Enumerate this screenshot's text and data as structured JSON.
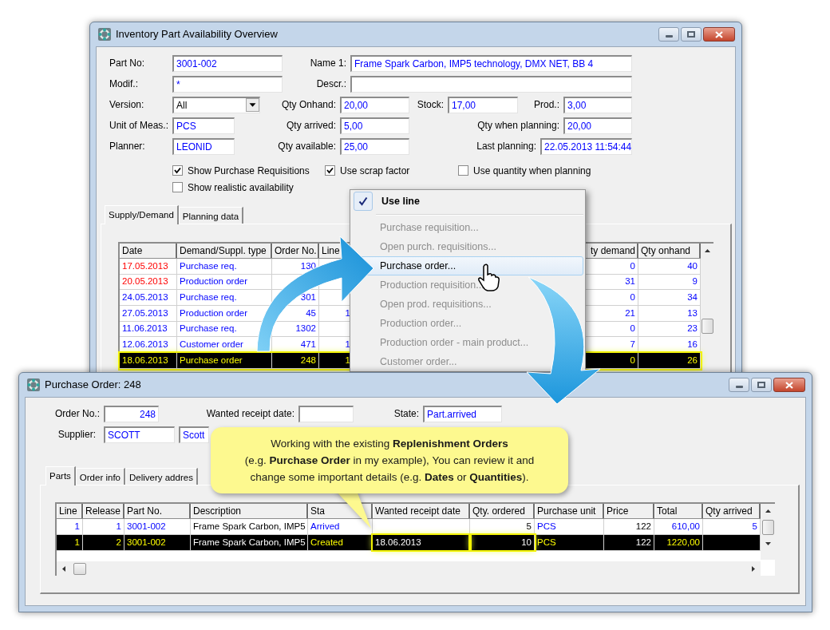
{
  "inventory_window": {
    "title": "Inventory Part Availability Overview",
    "fields": {
      "part_no": {
        "label": "Part No:",
        "value": "3001-002"
      },
      "name_1": {
        "label": "Name 1:",
        "value": "Frame Spark Carbon, IMP5 technology, DMX NET, BB 4"
      },
      "modif": {
        "label": "Modif.:",
        "value": "*"
      },
      "descr": {
        "label": "Descr.:"
      },
      "version": {
        "label": "Version:",
        "value": "All"
      },
      "qty_onhand": {
        "label": "Qty Onhand:",
        "value": "20,00"
      },
      "stock": {
        "label": "Stock:",
        "value": "17,00"
      },
      "prod": {
        "label": "Prod.:",
        "value": "3,00"
      },
      "unit": {
        "label": "Unit of Meas.:",
        "value": "PCS"
      },
      "qty_arrived": {
        "label": "Qty arrived:",
        "value": "5,00"
      },
      "qty_when_planning": {
        "label": "Qty when planning:",
        "value": "20,00"
      },
      "planner": {
        "label": "Planner:",
        "value": "LEONID"
      },
      "qty_available": {
        "label": "Qty available:",
        "value": "25,00"
      },
      "last_planning": {
        "label": "Last planning:",
        "value": "22.05.2013 11:54:44"
      }
    },
    "checkboxes": [
      {
        "label": "Show Purchase Requisitions",
        "checked": true
      },
      {
        "label": "Use scrap factor",
        "checked": true
      },
      {
        "label": "Use quantity when planning",
        "checked": false
      },
      {
        "label": "Show realistic availability",
        "checked": false
      }
    ],
    "tabs": [
      {
        "label": "Supply/Demand",
        "selected": true
      },
      {
        "label": "Planning data",
        "selected": false
      }
    ],
    "table": {
      "columns": [
        "Date",
        "Demand/Suppl. type",
        "Order No.",
        "Line",
        "ty demand",
        "Qty onhand"
      ],
      "rows": [
        {
          "date": "17.05.2013",
          "overdue": true,
          "type": "Purchase req.",
          "order_no": "130",
          "qty_demand": "0",
          "qty_onhand": "40",
          "selected": false,
          "highlighted": false
        },
        {
          "date": "20.05.2013",
          "overdue": true,
          "type": "Production order",
          "qty_demand": "31",
          "qty_onhand": "9",
          "selected": false,
          "highlighted": false
        },
        {
          "date": "24.05.2013",
          "overdue": false,
          "type": "Purchase req.",
          "order_no": "301",
          "qty_demand": "0",
          "qty_onhand": "34",
          "selected": false,
          "highlighted": false
        },
        {
          "date": "27.05.2013",
          "overdue": false,
          "type": "Production order",
          "order_no": "45",
          "line": "1",
          "qty_demand": "21",
          "qty_onhand": "13",
          "selected": false,
          "highlighted": false
        },
        {
          "date": "11.06.2013",
          "overdue": false,
          "type": "Purchase req.",
          "order_no": "1302",
          "qty_demand": "0",
          "qty_onhand": "23",
          "selected": false,
          "highlighted": false
        },
        {
          "date": "12.06.2013",
          "overdue": false,
          "type": "Customer order",
          "order_no": "471",
          "line": "1",
          "qty_demand": "7",
          "qty_onhand": "16",
          "selected": false,
          "highlighted": false
        },
        {
          "date": "18.06.2013",
          "overdue": false,
          "type": "Purchase order",
          "order_no": "248",
          "line": "1",
          "qty_demand": "0",
          "qty_onhand": "26",
          "selected": true,
          "highlighted": true
        }
      ]
    }
  },
  "context_menu": {
    "items": [
      {
        "kind": "check",
        "label": "Use line",
        "checked": true
      },
      {
        "kind": "separator"
      },
      {
        "kind": "action",
        "label": "Purchase requisition...",
        "disabled": true,
        "selected": false
      },
      {
        "kind": "action",
        "label": "Open purch. requisitions...",
        "disabled": true,
        "selected": false
      },
      {
        "kind": "action",
        "label": "Purchase order...",
        "disabled": false,
        "selected": true
      },
      {
        "kind": "action",
        "label": "Production requisition...",
        "disabled": true,
        "selected": false
      },
      {
        "kind": "action",
        "label": "Open prod. requisitions...",
        "disabled": true,
        "selected": false
      },
      {
        "kind": "action",
        "label": "Production order...",
        "disabled": true,
        "selected": false
      },
      {
        "kind": "action",
        "label": "Production order - main product...",
        "disabled": true,
        "selected": false
      },
      {
        "kind": "action",
        "label": "Customer order...",
        "disabled": true,
        "selected": false
      }
    ]
  },
  "purchase_window": {
    "title": "Purchase Order: 248",
    "fields": {
      "order_no": {
        "label": "Order No.:",
        "value": "248"
      },
      "wanted_receipt_date": {
        "label": "Wanted receipt date:"
      },
      "state": {
        "label": "State:",
        "value": "Part.arrived"
      },
      "supplier": {
        "label": "Supplier:",
        "value": "SCOTT"
      },
      "supplier_name": {
        "value": "Scott"
      }
    },
    "tabs": [
      {
        "label": "Parts",
        "selected": true
      },
      {
        "label": "Order info",
        "selected": false
      },
      {
        "label": "Delivery addres",
        "selected": false
      }
    ],
    "table": {
      "columns": [
        {
          "label": "Line",
          "highlighted": false
        },
        {
          "label": "Release",
          "highlighted": false
        },
        {
          "label": "Part No.",
          "highlighted": false
        },
        {
          "label": "Description",
          "highlighted": false
        },
        {
          "label": "Sta",
          "highlighted": false
        },
        {
          "label": "Wanted receipt date",
          "highlighted": true
        },
        {
          "label": "Qty. ordered",
          "highlighted": true
        },
        {
          "label": "Purchase unit",
          "highlighted": false
        },
        {
          "label": "Price",
          "highlighted": false
        },
        {
          "label": "Total",
          "highlighted": false
        },
        {
          "label": "Qty arrived",
          "highlighted": false
        }
      ],
      "rows": [
        {
          "line": "1",
          "release": "1",
          "part_no": "3001-002",
          "description": "Frame Spark Carbon, IMP5",
          "state": "Arrived",
          "qty_ordered": "5",
          "unit": "PCS",
          "price": "122",
          "total": "610,00",
          "qty_arrived": "5",
          "selected": false
        },
        {
          "line": "1",
          "release": "2",
          "part_no": "3001-002",
          "description": "Frame Spark Carbon, IMP5",
          "state": "Created",
          "wanted_date": "18.06.2013",
          "qty_ordered": "10",
          "unit": "PCS",
          "price": "122",
          "total": "1220,00",
          "selected": true
        }
      ]
    }
  },
  "callout": {
    "lines": [
      "Working with the existing **Replenishment Orders**",
      "(e.g. **Purchase Order** in my example), You can review it and",
      "change some important details (e.g. **Dates** or **Quantities**)."
    ]
  }
}
